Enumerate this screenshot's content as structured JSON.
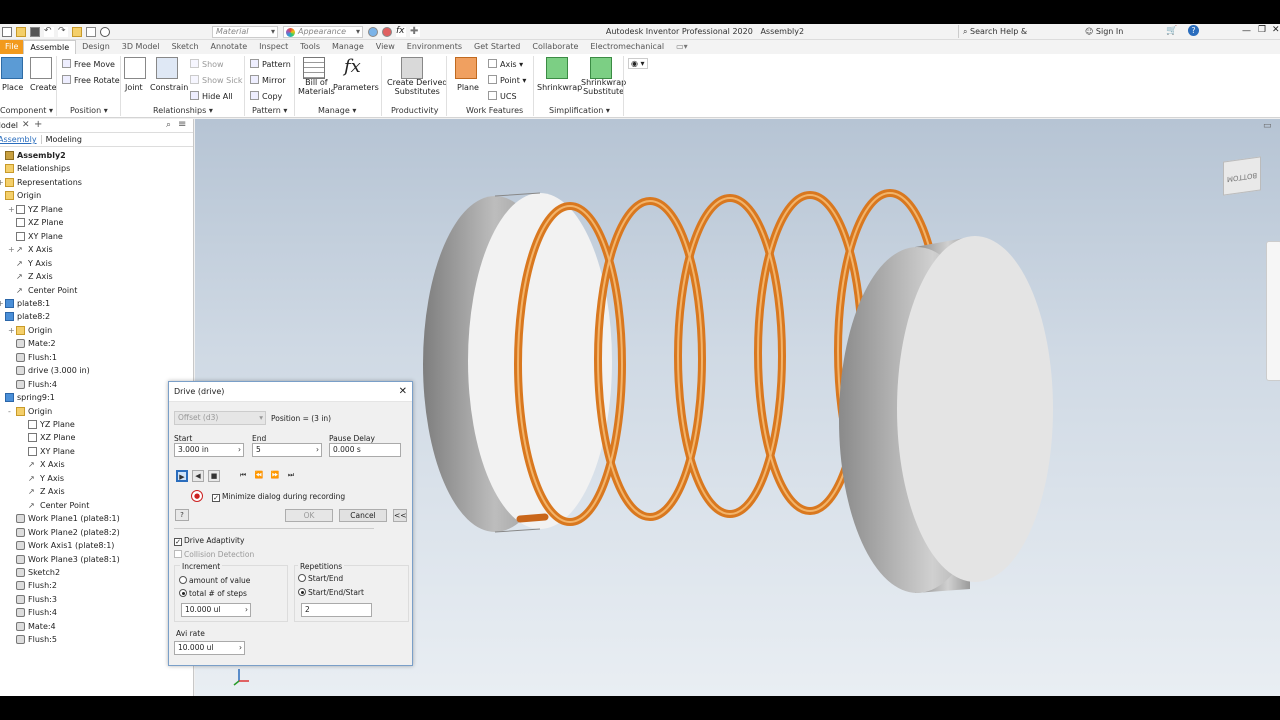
{
  "titlebar": {
    "app_title": "Autodesk Inventor Professional 2020",
    "doc": "Assembly2",
    "material": "Material",
    "appearance": "Appearance",
    "search_placeholder": "Search Help & Commands...",
    "sign_in": "Sign In"
  },
  "tabs": [
    "File",
    "Assemble",
    "Design",
    "3D Model",
    "Sketch",
    "Annotate",
    "Inspect",
    "Tools",
    "Manage",
    "View",
    "Environments",
    "Get Started",
    "Collaborate",
    "Electromechanical"
  ],
  "active_tab": "Assemble",
  "ribbon": {
    "place": "Place",
    "create": "Create",
    "free_move": "Free Move",
    "free_rotate": "Free Rotate",
    "joint": "Joint",
    "constrain": "Constrain",
    "show": "Show",
    "show_sick": "Show Sick",
    "hide_all": "Hide All",
    "pattern": "Pattern",
    "mirror": "Mirror",
    "copy": "Copy",
    "bom_1": "Bill of",
    "bom_2": "Materials",
    "parameters": "Parameters",
    "derived_1": "Create Derived",
    "derived_2": "Substitutes",
    "plane": "Plane",
    "axis": "Axis",
    "point": "Point",
    "ucs": "UCS",
    "shrinkwrap": "Shrinkwrap",
    "shrinkwrap_sub_1": "Shrinkwrap",
    "shrinkwrap_sub_2": "Substitute",
    "groups": {
      "component": "Component",
      "position": "Position",
      "relationships": "Relationships",
      "pattern": "Pattern",
      "manage": "Manage",
      "productivity": "Productivity",
      "work_features": "Work Features",
      "simplification": "Simplification"
    }
  },
  "panel": {
    "title": "Model",
    "subtab_assembly": "Assembly",
    "subtab_modeling": "Modeling"
  },
  "tree": [
    {
      "label": "Assembly2",
      "icon": "asm",
      "indent": 0,
      "exp": "-",
      "bold": true
    },
    {
      "label": "Relationships",
      "icon": "folder",
      "indent": 0,
      "exp": ""
    },
    {
      "label": "Representations",
      "icon": "folder",
      "indent": 0,
      "exp": "+"
    },
    {
      "label": "Origin",
      "icon": "folder",
      "indent": 0,
      "exp": "-"
    },
    {
      "label": "YZ Plane",
      "icon": "plane",
      "indent": 1,
      "exp": "+"
    },
    {
      "label": "XZ Plane",
      "icon": "plane",
      "indent": 1,
      "exp": ""
    },
    {
      "label": "XY Plane",
      "icon": "plane",
      "indent": 1,
      "exp": ""
    },
    {
      "label": "X Axis",
      "icon": "axis",
      "indent": 1,
      "exp": "+"
    },
    {
      "label": "Y Axis",
      "icon": "axis",
      "indent": 1,
      "exp": ""
    },
    {
      "label": "Z Axis",
      "icon": "axis",
      "indent": 1,
      "exp": ""
    },
    {
      "label": "Center Point",
      "icon": "axis",
      "indent": 1,
      "exp": ""
    },
    {
      "label": "plate8:1",
      "icon": "part",
      "indent": 0,
      "exp": "+"
    },
    {
      "label": "plate8:2",
      "icon": "part",
      "indent": 0,
      "exp": "-"
    },
    {
      "label": "Origin",
      "icon": "folder",
      "indent": 1,
      "exp": "+"
    },
    {
      "label": "Mate:2",
      "icon": "cons",
      "indent": 1,
      "exp": ""
    },
    {
      "label": "Flush:1",
      "icon": "cons",
      "indent": 1,
      "exp": ""
    },
    {
      "label": "drive (3.000 in)",
      "icon": "cons",
      "indent": 1,
      "exp": ""
    },
    {
      "label": "Flush:4",
      "icon": "cons",
      "indent": 1,
      "exp": ""
    },
    {
      "label": "spring9:1",
      "icon": "part",
      "indent": 0,
      "exp": "-"
    },
    {
      "label": "Origin",
      "icon": "folder",
      "indent": 1,
      "exp": "-"
    },
    {
      "label": "YZ Plane",
      "icon": "plane",
      "indent": 2,
      "exp": ""
    },
    {
      "label": "XZ Plane",
      "icon": "plane",
      "indent": 2,
      "exp": ""
    },
    {
      "label": "XY Plane",
      "icon": "plane",
      "indent": 2,
      "exp": ""
    },
    {
      "label": "X Axis",
      "icon": "axis",
      "indent": 2,
      "exp": ""
    },
    {
      "label": "Y Axis",
      "icon": "axis",
      "indent": 2,
      "exp": ""
    },
    {
      "label": "Z Axis",
      "icon": "axis",
      "indent": 2,
      "exp": ""
    },
    {
      "label": "Center Point",
      "icon": "axis",
      "indent": 2,
      "exp": ""
    },
    {
      "label": "Work Plane1 (plate8:1)",
      "icon": "cons",
      "indent": 1,
      "exp": ""
    },
    {
      "label": "Work Plane2 (plate8:2)",
      "icon": "cons",
      "indent": 1,
      "exp": ""
    },
    {
      "label": "Work Axis1 (plate8:1)",
      "icon": "cons",
      "indent": 1,
      "exp": ""
    },
    {
      "label": "Work Plane3 (plate8:1)",
      "icon": "cons",
      "indent": 1,
      "exp": ""
    },
    {
      "label": "Sketch2",
      "icon": "cons",
      "indent": 1,
      "exp": ""
    },
    {
      "label": "Flush:2",
      "icon": "cons",
      "indent": 1,
      "exp": ""
    },
    {
      "label": "Flush:3",
      "icon": "cons",
      "indent": 1,
      "exp": ""
    },
    {
      "label": "Flush:4",
      "icon": "cons",
      "indent": 1,
      "exp": ""
    },
    {
      "label": "Mate:4",
      "icon": "cons",
      "indent": 1,
      "exp": ""
    },
    {
      "label": "Flush:5",
      "icon": "cons",
      "indent": 1,
      "exp": ""
    }
  ],
  "viewcube": {
    "face": "BOTTOM"
  },
  "dialog": {
    "title": "Drive (drive)",
    "offset_dropdown": "Offset (d3)",
    "position": "Position = (3 in)",
    "start_label": "Start",
    "start_value": "3.000 in",
    "end_label": "End",
    "end_value": "5",
    "pause_label": "Pause Delay",
    "pause_value": "0.000 s",
    "minimize_label": "Minimize dialog during recording",
    "ok": "OK",
    "cancel": "Cancel",
    "collapse": "<<",
    "drive_adaptivity": "Drive Adaptivity",
    "collision": "Collision Detection",
    "increment_label": "Increment",
    "amount_label": "amount of value",
    "total_label": "total # of steps",
    "increment_value": "10.000 ul",
    "repetitions_label": "Repetitions",
    "start_end": "Start/End",
    "start_end_start": "Start/End/Start",
    "repetitions_value": "2",
    "avi_label": "Avi rate",
    "avi_value": "10.000 ul"
  },
  "colors": {
    "file_tab": "#f29a1d",
    "spring": "#d9781f",
    "plate": "#d8d8d8"
  }
}
